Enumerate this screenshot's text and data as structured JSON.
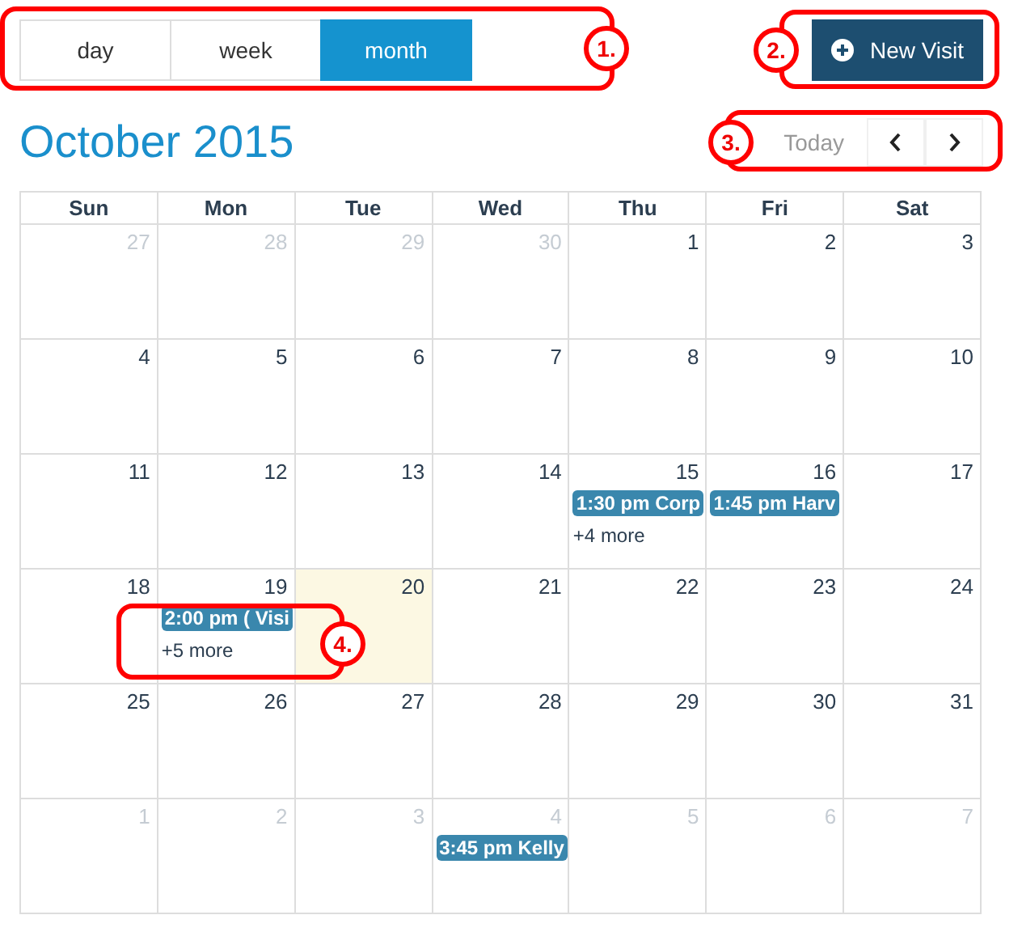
{
  "views": [
    {
      "label": "day",
      "selected": false
    },
    {
      "label": "week",
      "selected": false
    },
    {
      "label": "month",
      "selected": true
    }
  ],
  "new_visit_button": {
    "label": "New Visit"
  },
  "title": "October 2015",
  "nav": {
    "today": {
      "label": "Today",
      "disabled": true
    }
  },
  "weekdays": [
    "Sun",
    "Mon",
    "Tue",
    "Wed",
    "Thu",
    "Fri",
    "Sat"
  ],
  "weeks": [
    [
      {
        "day": "27",
        "other_month": true,
        "today": false
      },
      {
        "day": "28",
        "other_month": true,
        "today": false
      },
      {
        "day": "29",
        "other_month": true,
        "today": false
      },
      {
        "day": "30",
        "other_month": true,
        "today": false
      },
      {
        "day": "1",
        "other_month": false,
        "today": false
      },
      {
        "day": "2",
        "other_month": false,
        "today": false
      },
      {
        "day": "3",
        "other_month": false,
        "today": false
      }
    ],
    [
      {
        "day": "4",
        "other_month": false,
        "today": false
      },
      {
        "day": "5",
        "other_month": false,
        "today": false
      },
      {
        "day": "6",
        "other_month": false,
        "today": false
      },
      {
        "day": "7",
        "other_month": false,
        "today": false
      },
      {
        "day": "8",
        "other_month": false,
        "today": false
      },
      {
        "day": "9",
        "other_month": false,
        "today": false
      },
      {
        "day": "10",
        "other_month": false,
        "today": false
      }
    ],
    [
      {
        "day": "11",
        "other_month": false,
        "today": false
      },
      {
        "day": "12",
        "other_month": false,
        "today": false
      },
      {
        "day": "13",
        "other_month": false,
        "today": false
      },
      {
        "day": "14",
        "other_month": false,
        "today": false
      },
      {
        "day": "15",
        "other_month": false,
        "today": false,
        "events": [
          "1:30 pm Corp"
        ],
        "more": "+4 more"
      },
      {
        "day": "16",
        "other_month": false,
        "today": false,
        "events": [
          "1:45 pm Harv"
        ]
      },
      {
        "day": "17",
        "other_month": false,
        "today": false
      }
    ],
    [
      {
        "day": "18",
        "other_month": false,
        "today": false
      },
      {
        "day": "19",
        "other_month": false,
        "today": false,
        "events": [
          "2:00 pm ( Visi"
        ],
        "more": "+5 more"
      },
      {
        "day": "20",
        "other_month": false,
        "today": true
      },
      {
        "day": "21",
        "other_month": false,
        "today": false
      },
      {
        "day": "22",
        "other_month": false,
        "today": false
      },
      {
        "day": "23",
        "other_month": false,
        "today": false
      },
      {
        "day": "24",
        "other_month": false,
        "today": false
      }
    ],
    [
      {
        "day": "25",
        "other_month": false,
        "today": false
      },
      {
        "day": "26",
        "other_month": false,
        "today": false
      },
      {
        "day": "27",
        "other_month": false,
        "today": false
      },
      {
        "day": "28",
        "other_month": false,
        "today": false
      },
      {
        "day": "29",
        "other_month": false,
        "today": false
      },
      {
        "day": "30",
        "other_month": false,
        "today": false
      },
      {
        "day": "31",
        "other_month": false,
        "today": false
      }
    ],
    [
      {
        "day": "1",
        "other_month": true,
        "today": false
      },
      {
        "day": "2",
        "other_month": true,
        "today": false
      },
      {
        "day": "3",
        "other_month": true,
        "today": false
      },
      {
        "day": "4",
        "other_month": true,
        "today": false,
        "events": [
          "3:45 pm Kelly"
        ]
      },
      {
        "day": "5",
        "other_month": true,
        "today": false
      },
      {
        "day": "6",
        "other_month": true,
        "today": false
      },
      {
        "day": "7",
        "other_month": true,
        "today": false
      }
    ]
  ],
  "callouts": [
    "1.",
    "2.",
    "3.",
    "4."
  ]
}
